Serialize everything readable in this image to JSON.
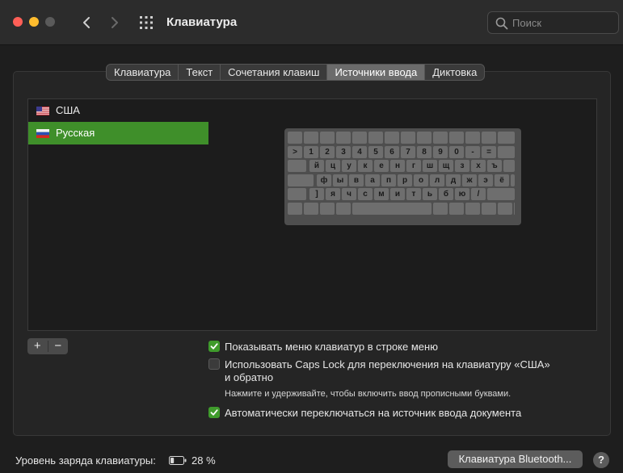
{
  "window": {
    "title": "Клавиатура"
  },
  "search": {
    "placeholder": "Поиск"
  },
  "tabs": [
    {
      "label": "Клавиатура",
      "active": false
    },
    {
      "label": "Текст",
      "active": false
    },
    {
      "label": "Сочетания клавиш",
      "active": false
    },
    {
      "label": "Источники ввода",
      "active": true
    },
    {
      "label": "Диктовка",
      "active": false
    }
  ],
  "input_sources": [
    {
      "label": "США",
      "flag": "us-flag-icon",
      "selected": false
    },
    {
      "label": "Русская",
      "flag": "ru-flag-icon",
      "selected": true
    }
  ],
  "list_controls": {
    "add_label": "+",
    "remove_label": "−"
  },
  "keyboard_preview": {
    "rows": [
      [
        ">",
        "1",
        "2",
        "3",
        "4",
        "5",
        "6",
        "7",
        "8",
        "9",
        "0",
        "-",
        "="
      ],
      [
        "й",
        "ц",
        "у",
        "к",
        "е",
        "н",
        "г",
        "ш",
        "щ",
        "з",
        "х",
        "ъ"
      ],
      [
        "ф",
        "ы",
        "в",
        "а",
        "п",
        "р",
        "о",
        "л",
        "д",
        "ж",
        "э",
        "ё"
      ],
      [
        "]",
        "я",
        "ч",
        "с",
        "м",
        "и",
        "т",
        "ь",
        "б",
        "ю",
        "/"
      ]
    ]
  },
  "options": {
    "show_menu": {
      "label": "Показывать меню клавиатур в строке меню",
      "checked": true
    },
    "caps_lock": {
      "line1": "Использовать Caps Lock для переключения на клавиатуру «США»",
      "line2": "и обратно",
      "hint": "Нажмите и удерживайте, чтобы включить ввод прописными буквами.",
      "checked": false
    },
    "auto_switch": {
      "label": "Автоматически переключаться на источник ввода документа",
      "checked": true
    }
  },
  "footer": {
    "battery_label": "Уровень заряда клавиатуры:",
    "battery_percent": "28 %",
    "battery_level": 0.28,
    "bluetooth_button": "Клавиатура Bluetooth...",
    "help_label": "?"
  },
  "colors": {
    "accent_green": "#3f8f2a",
    "close": "#ff5f57",
    "minimize": "#febc2e"
  }
}
